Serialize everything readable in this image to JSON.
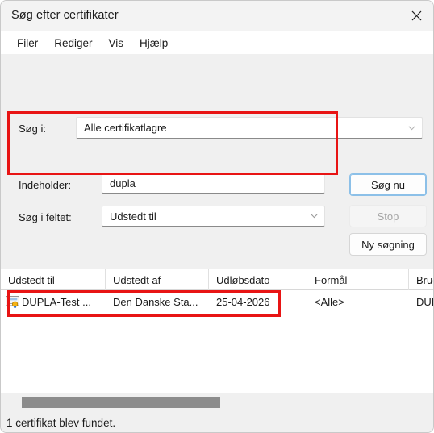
{
  "window": {
    "title": "Søg efter certifikater",
    "close_icon": "close-icon"
  },
  "menubar": {
    "items": [
      {
        "label": "Filer"
      },
      {
        "label": "Rediger"
      },
      {
        "label": "Vis"
      },
      {
        "label": "Hjælp"
      }
    ]
  },
  "search_panel": {
    "scope_label": "Søg i:",
    "scope_value": "Alle certifikatlagre",
    "contains_label": "Indeholder:",
    "contains_value": "dupla",
    "contains_placeholder": "",
    "field_label": "Søg i feltet:",
    "field_value": "Udstedt til",
    "graphic_icon": "certificate-search-icon"
  },
  "buttons": {
    "search_now": "Søg nu",
    "stop": "Stop",
    "new_search": "Ny søgning"
  },
  "results": {
    "columns": [
      {
        "label": "Udstedt til"
      },
      {
        "label": "Udstedt af"
      },
      {
        "label": "Udløbsdato"
      },
      {
        "label": "Formål"
      },
      {
        "label": "Brug"
      }
    ],
    "rows": [
      {
        "icon": "certificate-icon",
        "issued_to": "DUPLA-Test ...",
        "issued_by": "Den Danske Sta...",
        "expiry": "25-04-2026",
        "purpose": "<Alle>",
        "friendly_name": "DUP"
      }
    ]
  },
  "statusbar": {
    "text": "1 certifikat blev fundet."
  },
  "colors": {
    "annotation": "#e81414",
    "focus": "#8cc0e8",
    "window_bg": "#f0f0f0"
  }
}
